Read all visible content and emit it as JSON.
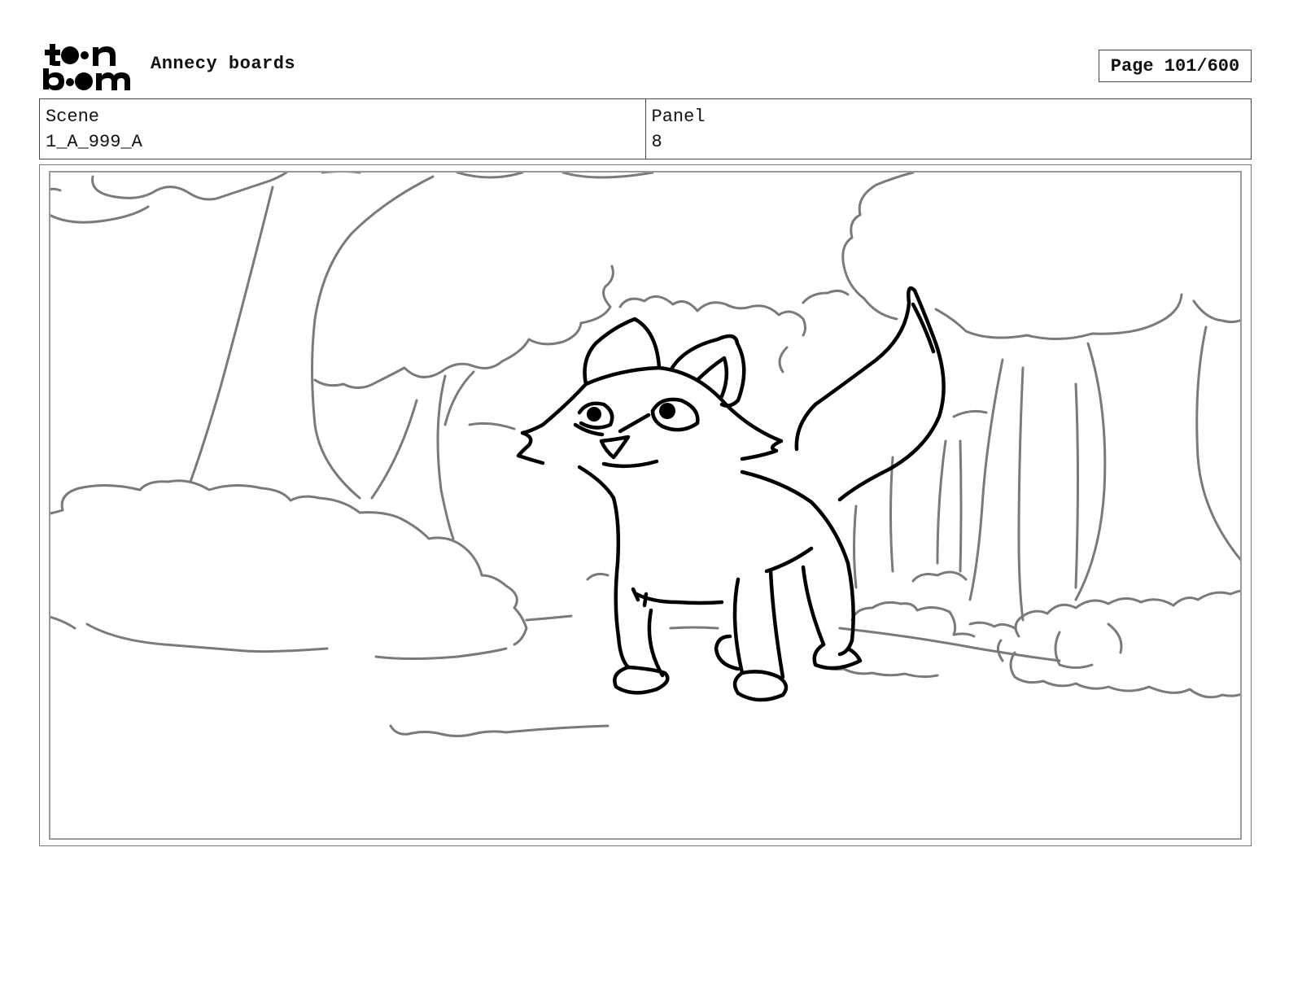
{
  "header": {
    "logo_text": "toon boom",
    "project_title": "Annecy boards",
    "page_label": "Page 101/600"
  },
  "info": {
    "scene_label": "Scene",
    "scene_value": "1_A_999_A",
    "panel_label": "Panel",
    "panel_value": "8"
  },
  "panel_image": {
    "description_icon": "storyboard-sketch-fox-forest"
  }
}
